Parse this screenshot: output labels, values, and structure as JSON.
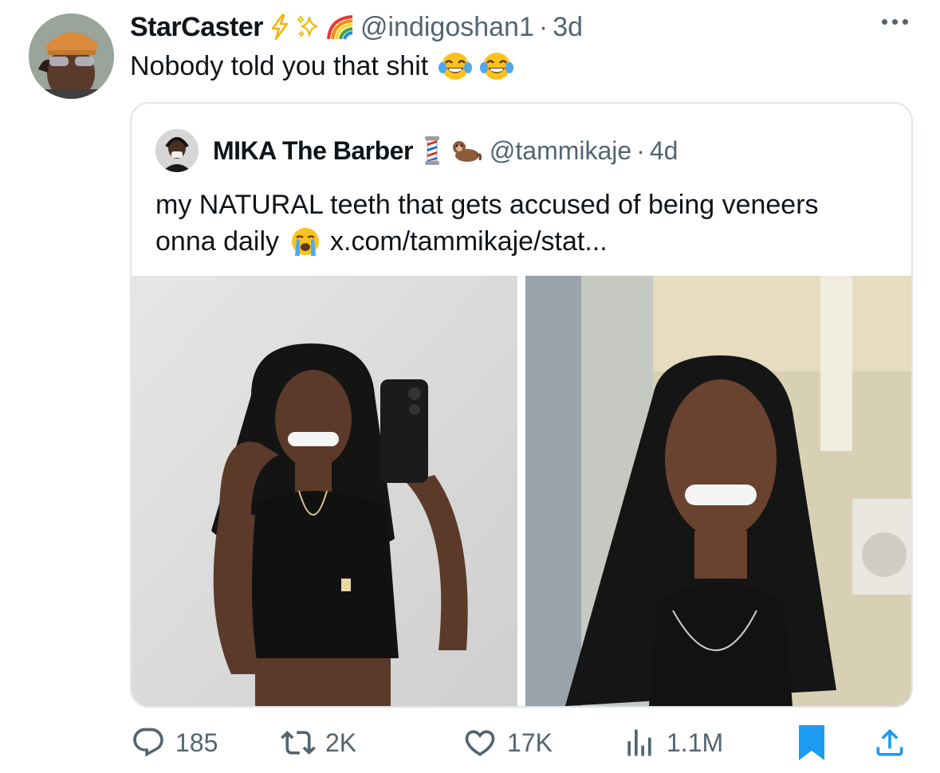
{
  "tweet": {
    "author_name": "StarCaster",
    "author_handle": "@indigoshan1",
    "separator": "·",
    "time": "3d",
    "text": "Nobody told you that shit",
    "badges": [
      "lightning-icon",
      "sparkles-icon",
      "rainbow-icon"
    ],
    "emojis": [
      "tears-of-joy-emoji",
      "tears-of-joy-emoji"
    ]
  },
  "quote": {
    "author_name": "MIKA The Barber",
    "author_handle": "@tammikaje",
    "separator": "·",
    "time": "4d",
    "text_line1": "my NATURAL teeth that gets accused of being veneers",
    "text_line2_prefix": "onna daily",
    "link": "x.com/tammikaje/stat...",
    "badges": [
      "barber-pole-icon",
      "otter-icon"
    ],
    "emoji": "loudly-crying-emoji",
    "images": [
      "mirror-selfie-photo",
      "smiling-selfie-photo"
    ]
  },
  "actions": {
    "replies": "185",
    "reposts": "2K",
    "likes": "17K",
    "views": "1.1M"
  },
  "colors": {
    "text_primary": "#0f1419",
    "text_secondary": "#536471",
    "bookmark_blue": "#1d9bf0",
    "border": "#e1e6ea"
  }
}
